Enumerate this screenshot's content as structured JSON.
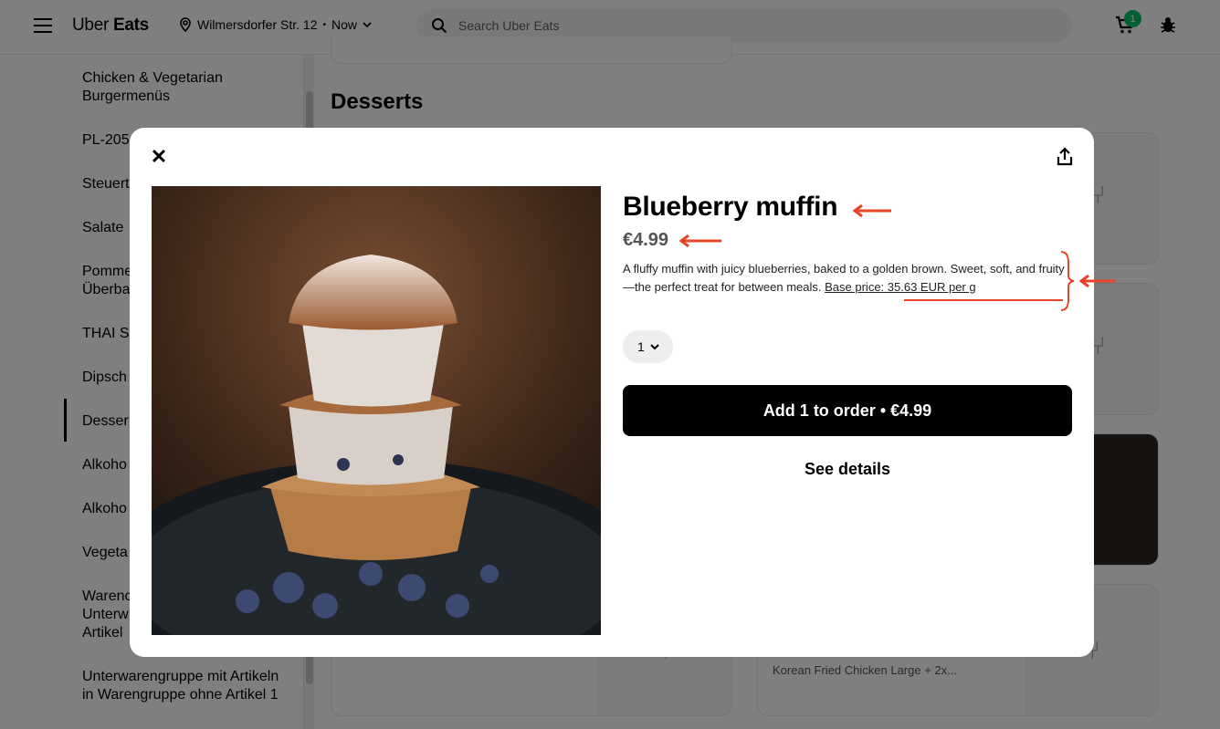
{
  "header": {
    "brand_light": "Uber",
    "brand_bold": "Eats",
    "location": "Wilmersdorfer Str. 12",
    "time": "Now",
    "search_placeholder": "Search Uber Eats",
    "cart_count": "1"
  },
  "sidebar": {
    "items": [
      "Chicken & Vegetarian Burgermenüs",
      "PL-205",
      "Steuert",
      "Salate",
      "Pomme Überba",
      "THAI So",
      "Dipsch",
      "Desser",
      "Alkoho",
      "Alkoho",
      "Vegeta",
      "Warenc Unterw Artikel",
      "Unterwarengruppe mit Artikeln in Warengruppe ohne Artikel 1"
    ],
    "active_index": 7
  },
  "main": {
    "section_title": "Desserts",
    "card_snippet": "Korean Fried Chicken Large + 2x..."
  },
  "modal": {
    "title": "Blueberry muffin",
    "price": "€4.99",
    "description": "A fluffy muffin with juicy blueberries, baked to a golden brown. Sweet, soft, and fruity—the perfect treat for between meals.",
    "base_price": "Base price: 35.63 EUR per g",
    "quantity": "1",
    "add_button": "Add 1 to order • €4.99",
    "details_button": "See details"
  },
  "colors": {
    "accent_green": "#06c167",
    "annotation_red": "#e8442a"
  }
}
